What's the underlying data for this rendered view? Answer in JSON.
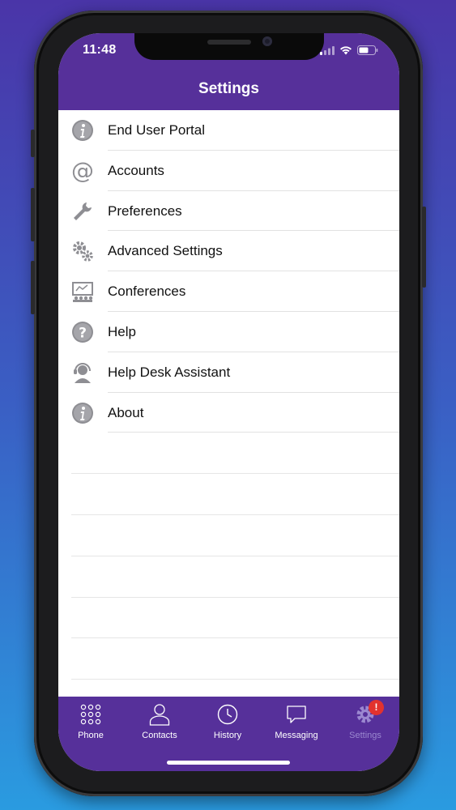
{
  "status_bar": {
    "time": "11:48"
  },
  "header": {
    "title": "Settings"
  },
  "menu": {
    "items": [
      {
        "label": "End User Portal",
        "icon": "info-icon"
      },
      {
        "label": "Accounts",
        "icon": "at-icon"
      },
      {
        "label": "Preferences",
        "icon": "wrench-icon"
      },
      {
        "label": "Advanced Settings",
        "icon": "gears-icon"
      },
      {
        "label": "Conferences",
        "icon": "conference-icon"
      },
      {
        "label": "Help",
        "icon": "help-icon"
      },
      {
        "label": "Help Desk Assistant",
        "icon": "headset-icon"
      },
      {
        "label": "About",
        "icon": "info-icon"
      }
    ]
  },
  "tabbar": {
    "tabs": [
      {
        "label": "Phone",
        "icon": "keypad-icon"
      },
      {
        "label": "Contacts",
        "icon": "person-icon"
      },
      {
        "label": "History",
        "icon": "clock-icon"
      },
      {
        "label": "Messaging",
        "icon": "chat-bubble-icon"
      },
      {
        "label": "Settings",
        "icon": "gear-icon",
        "active": true
      }
    ],
    "settings_badge": "!"
  },
  "colors": {
    "header_bg": "#56309a",
    "tab_active": "#9b88d0",
    "badge": "#e2322e",
    "icon_gray": "#8e8e93"
  }
}
